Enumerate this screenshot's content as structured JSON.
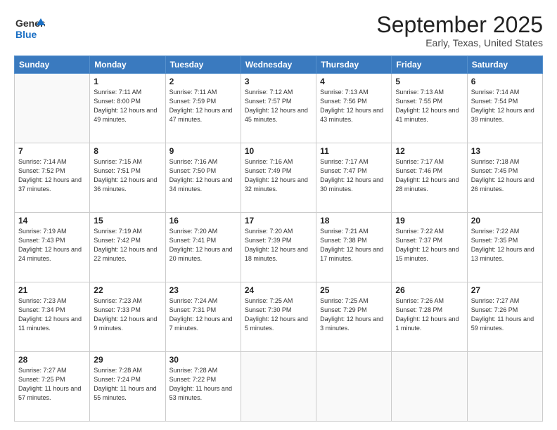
{
  "header": {
    "logo_general": "General",
    "logo_blue": "Blue",
    "month": "September 2025",
    "location": "Early, Texas, United States"
  },
  "weekdays": [
    "Sunday",
    "Monday",
    "Tuesday",
    "Wednesday",
    "Thursday",
    "Friday",
    "Saturday"
  ],
  "weeks": [
    [
      {
        "day": "",
        "info": ""
      },
      {
        "day": "1",
        "info": "Sunrise: 7:11 AM\nSunset: 8:00 PM\nDaylight: 12 hours\nand 49 minutes."
      },
      {
        "day": "2",
        "info": "Sunrise: 7:11 AM\nSunset: 7:59 PM\nDaylight: 12 hours\nand 47 minutes."
      },
      {
        "day": "3",
        "info": "Sunrise: 7:12 AM\nSunset: 7:57 PM\nDaylight: 12 hours\nand 45 minutes."
      },
      {
        "day": "4",
        "info": "Sunrise: 7:13 AM\nSunset: 7:56 PM\nDaylight: 12 hours\nand 43 minutes."
      },
      {
        "day": "5",
        "info": "Sunrise: 7:13 AM\nSunset: 7:55 PM\nDaylight: 12 hours\nand 41 minutes."
      },
      {
        "day": "6",
        "info": "Sunrise: 7:14 AM\nSunset: 7:54 PM\nDaylight: 12 hours\nand 39 minutes."
      }
    ],
    [
      {
        "day": "7",
        "info": "Sunrise: 7:14 AM\nSunset: 7:52 PM\nDaylight: 12 hours\nand 37 minutes."
      },
      {
        "day": "8",
        "info": "Sunrise: 7:15 AM\nSunset: 7:51 PM\nDaylight: 12 hours\nand 36 minutes."
      },
      {
        "day": "9",
        "info": "Sunrise: 7:16 AM\nSunset: 7:50 PM\nDaylight: 12 hours\nand 34 minutes."
      },
      {
        "day": "10",
        "info": "Sunrise: 7:16 AM\nSunset: 7:49 PM\nDaylight: 12 hours\nand 32 minutes."
      },
      {
        "day": "11",
        "info": "Sunrise: 7:17 AM\nSunset: 7:47 PM\nDaylight: 12 hours\nand 30 minutes."
      },
      {
        "day": "12",
        "info": "Sunrise: 7:17 AM\nSunset: 7:46 PM\nDaylight: 12 hours\nand 28 minutes."
      },
      {
        "day": "13",
        "info": "Sunrise: 7:18 AM\nSunset: 7:45 PM\nDaylight: 12 hours\nand 26 minutes."
      }
    ],
    [
      {
        "day": "14",
        "info": "Sunrise: 7:19 AM\nSunset: 7:43 PM\nDaylight: 12 hours\nand 24 minutes."
      },
      {
        "day": "15",
        "info": "Sunrise: 7:19 AM\nSunset: 7:42 PM\nDaylight: 12 hours\nand 22 minutes."
      },
      {
        "day": "16",
        "info": "Sunrise: 7:20 AM\nSunset: 7:41 PM\nDaylight: 12 hours\nand 20 minutes."
      },
      {
        "day": "17",
        "info": "Sunrise: 7:20 AM\nSunset: 7:39 PM\nDaylight: 12 hours\nand 18 minutes."
      },
      {
        "day": "18",
        "info": "Sunrise: 7:21 AM\nSunset: 7:38 PM\nDaylight: 12 hours\nand 17 minutes."
      },
      {
        "day": "19",
        "info": "Sunrise: 7:22 AM\nSunset: 7:37 PM\nDaylight: 12 hours\nand 15 minutes."
      },
      {
        "day": "20",
        "info": "Sunrise: 7:22 AM\nSunset: 7:35 PM\nDaylight: 12 hours\nand 13 minutes."
      }
    ],
    [
      {
        "day": "21",
        "info": "Sunrise: 7:23 AM\nSunset: 7:34 PM\nDaylight: 12 hours\nand 11 minutes."
      },
      {
        "day": "22",
        "info": "Sunrise: 7:23 AM\nSunset: 7:33 PM\nDaylight: 12 hours\nand 9 minutes."
      },
      {
        "day": "23",
        "info": "Sunrise: 7:24 AM\nSunset: 7:31 PM\nDaylight: 12 hours\nand 7 minutes."
      },
      {
        "day": "24",
        "info": "Sunrise: 7:25 AM\nSunset: 7:30 PM\nDaylight: 12 hours\nand 5 minutes."
      },
      {
        "day": "25",
        "info": "Sunrise: 7:25 AM\nSunset: 7:29 PM\nDaylight: 12 hours\nand 3 minutes."
      },
      {
        "day": "26",
        "info": "Sunrise: 7:26 AM\nSunset: 7:28 PM\nDaylight: 12 hours\nand 1 minute."
      },
      {
        "day": "27",
        "info": "Sunrise: 7:27 AM\nSunset: 7:26 PM\nDaylight: 11 hours\nand 59 minutes."
      }
    ],
    [
      {
        "day": "28",
        "info": "Sunrise: 7:27 AM\nSunset: 7:25 PM\nDaylight: 11 hours\nand 57 minutes."
      },
      {
        "day": "29",
        "info": "Sunrise: 7:28 AM\nSunset: 7:24 PM\nDaylight: 11 hours\nand 55 minutes."
      },
      {
        "day": "30",
        "info": "Sunrise: 7:28 AM\nSunset: 7:22 PM\nDaylight: 11 hours\nand 53 minutes."
      },
      {
        "day": "",
        "info": ""
      },
      {
        "day": "",
        "info": ""
      },
      {
        "day": "",
        "info": ""
      },
      {
        "day": "",
        "info": ""
      }
    ]
  ]
}
